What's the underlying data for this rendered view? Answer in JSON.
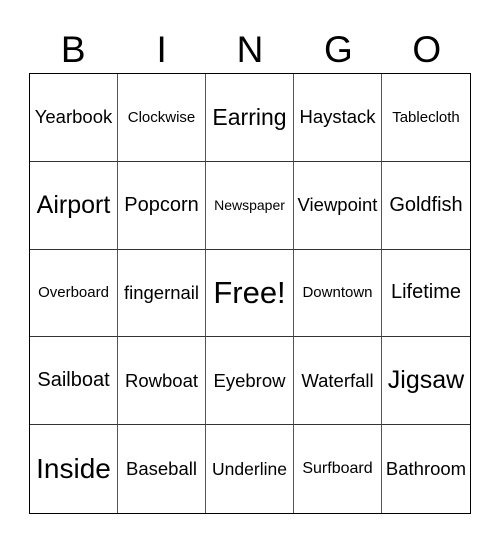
{
  "card": {
    "header": [
      "B",
      "I",
      "N",
      "G",
      "O"
    ],
    "rows": [
      [
        "Yearbook",
        "Clockwise",
        "Earring",
        "Haystack",
        "Tablecloth"
      ],
      [
        "Airport",
        "Popcorn",
        "Newspaper",
        "Viewpoint",
        "Goldfish"
      ],
      [
        "Overboard",
        "fingernail",
        "Free!",
        "Downtown",
        "Lifetime"
      ],
      [
        "Sailboat",
        "Rowboat",
        "Eyebrow",
        "Waterfall",
        "Jigsaw"
      ],
      [
        "Inside",
        "Baseball",
        "Underline",
        "Surfboard",
        "Bathroom"
      ]
    ],
    "free_space_label": "Free!"
  },
  "colors": {
    "text": "#000000",
    "background": "#ffffff",
    "outer_border": "#000000",
    "inner_lines": "#555555"
  }
}
